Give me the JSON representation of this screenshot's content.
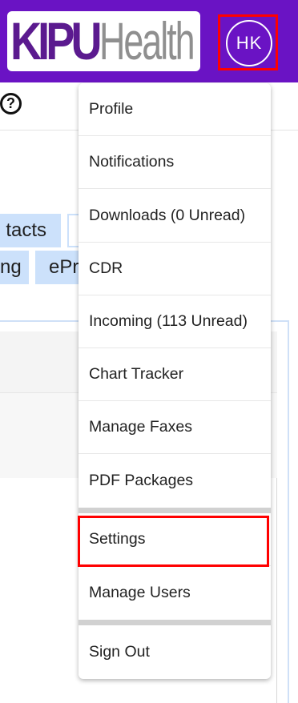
{
  "header": {
    "logo": {
      "kipu_text": "KIPU",
      "health_text": "Health",
      "brand_color": "#6a13c4"
    },
    "avatar": {
      "initials": "HK"
    }
  },
  "subheader": {
    "help_icon": "question-circle-icon",
    "help_glyph": "?"
  },
  "background_tabs": {
    "contacts_partial": "tacts",
    "ng_partial": "ng",
    "epr_partial": "ePr"
  },
  "menu": {
    "items": [
      {
        "label": "Profile"
      },
      {
        "label": "Notifications"
      },
      {
        "label": "Downloads (0 Unread)"
      },
      {
        "label": "CDR"
      },
      {
        "label": "Incoming (113 Unread)"
      },
      {
        "label": "Chart Tracker"
      },
      {
        "label": "Manage Faxes"
      },
      {
        "label": "PDF Packages"
      },
      {
        "label": "Settings"
      },
      {
        "label": "Manage Users"
      },
      {
        "label": "Sign Out"
      }
    ]
  },
  "colors": {
    "highlight": "#ff0000",
    "tab_bg": "#cce1fb",
    "header_bg": "#6a13c4"
  }
}
